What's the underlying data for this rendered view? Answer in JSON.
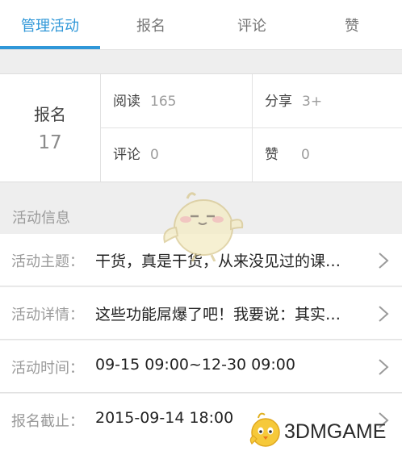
{
  "tabs": [
    {
      "label": "管理活动",
      "active": true
    },
    {
      "label": "报名",
      "active": false
    },
    {
      "label": "评论",
      "active": false
    },
    {
      "label": "赞",
      "active": false
    }
  ],
  "stats": {
    "signup_label": "报名",
    "signup_count": "17",
    "read_label": "阅读",
    "read_count": "165",
    "share_label": "分享",
    "share_count": "3+",
    "comment_label": "评论",
    "comment_count": "0",
    "like_label": "赞",
    "like_count": "0"
  },
  "section_title": "活动信息",
  "rows": [
    {
      "label": "活动主题：",
      "value": "干货，真是干货，从来没见过的课…"
    },
    {
      "label": "活动详情：",
      "value": "这些功能屌爆了吧！我要说：其实…"
    },
    {
      "label": "活动时间：",
      "value": "09-15 09:00~12-30 09:00"
    },
    {
      "label": "报名截止：",
      "value": "2015-09-14 18:00"
    }
  ],
  "watermark": {
    "text": "3DMGAME"
  },
  "colors": {
    "accent": "#2f97d8",
    "background": "#eeeeee"
  },
  "icons": [
    "chevron-right-icon",
    "mascot-bird-icon"
  ]
}
